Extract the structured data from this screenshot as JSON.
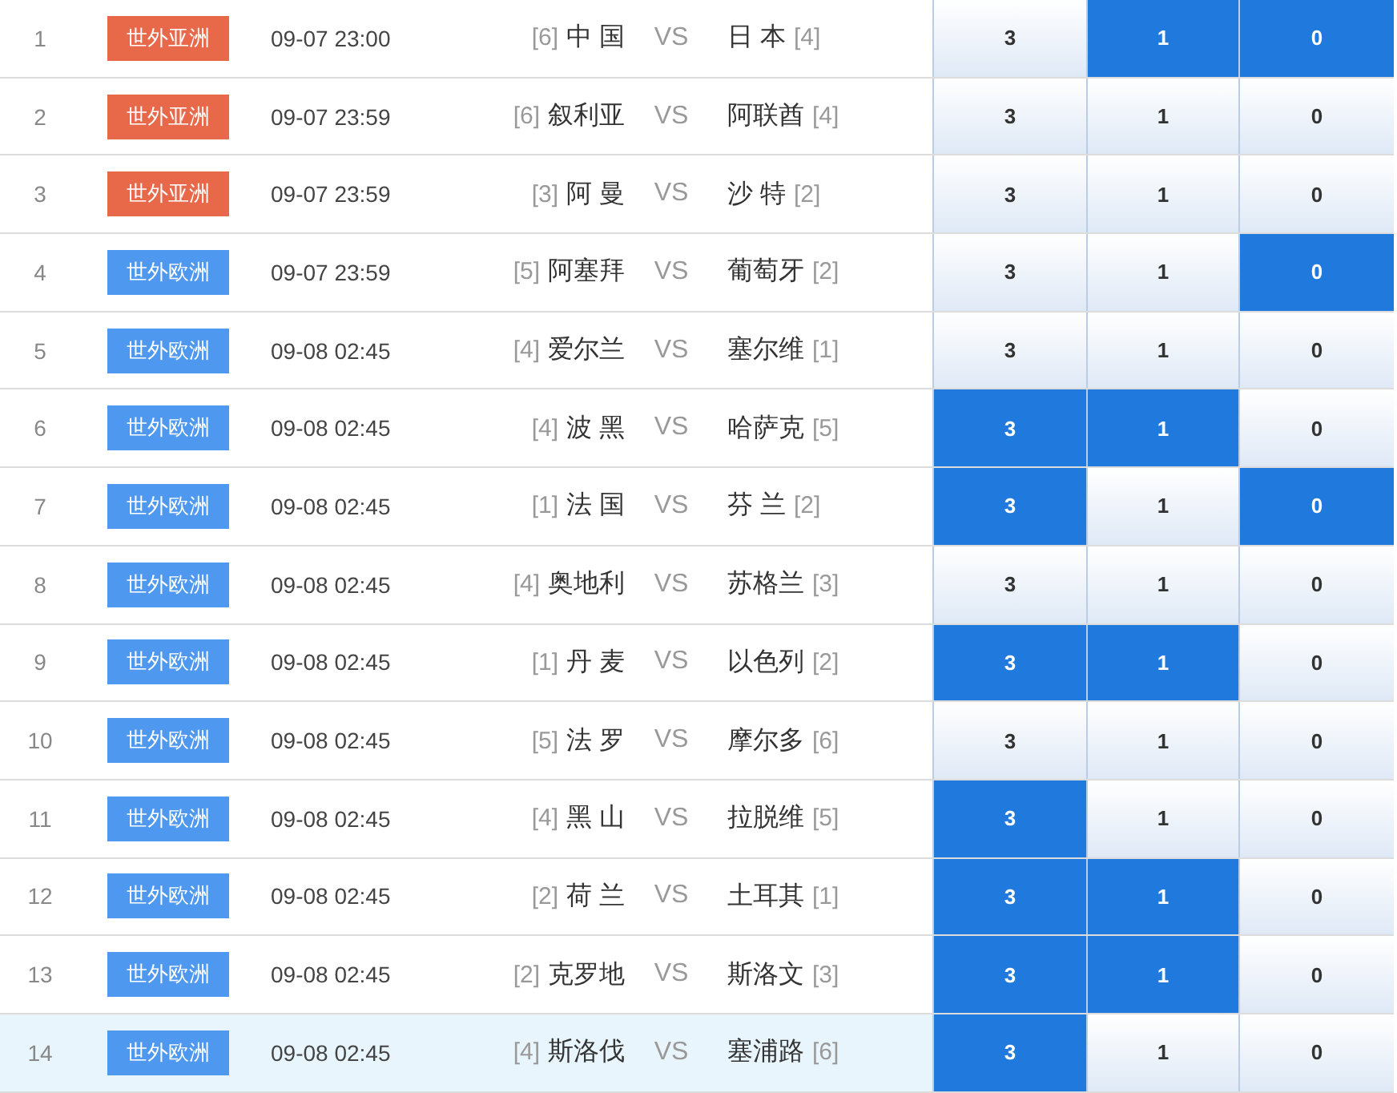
{
  "matches": [
    {
      "number": "1",
      "league": {
        "label": "世外亚洲",
        "kind": "asia"
      },
      "time": "09-07 23:00",
      "home": {
        "rank": "[6]",
        "name": "中 国"
      },
      "vs": "VS",
      "away": {
        "name": "日 本",
        "rank": "[4]"
      },
      "highlighted": false,
      "odds": [
        {
          "value": "3",
          "selected": false
        },
        {
          "value": "1",
          "selected": true
        },
        {
          "value": "0",
          "selected": true
        }
      ]
    },
    {
      "number": "2",
      "league": {
        "label": "世外亚洲",
        "kind": "asia"
      },
      "time": "09-07 23:59",
      "home": {
        "rank": "[6]",
        "name": "叙利亚"
      },
      "vs": "VS",
      "away": {
        "name": "阿联酋",
        "rank": "[4]"
      },
      "highlighted": false,
      "odds": [
        {
          "value": "3",
          "selected": false
        },
        {
          "value": "1",
          "selected": false
        },
        {
          "value": "0",
          "selected": false
        }
      ]
    },
    {
      "number": "3",
      "league": {
        "label": "世外亚洲",
        "kind": "asia"
      },
      "time": "09-07 23:59",
      "home": {
        "rank": "[3]",
        "name": "阿 曼"
      },
      "vs": "VS",
      "away": {
        "name": "沙 特",
        "rank": "[2]"
      },
      "highlighted": false,
      "odds": [
        {
          "value": "3",
          "selected": false
        },
        {
          "value": "1",
          "selected": false
        },
        {
          "value": "0",
          "selected": false
        }
      ]
    },
    {
      "number": "4",
      "league": {
        "label": "世外欧洲",
        "kind": "europe"
      },
      "time": "09-07 23:59",
      "home": {
        "rank": "[5]",
        "name": "阿塞拜"
      },
      "vs": "VS",
      "away": {
        "name": "葡萄牙",
        "rank": "[2]"
      },
      "highlighted": false,
      "odds": [
        {
          "value": "3",
          "selected": false
        },
        {
          "value": "1",
          "selected": false
        },
        {
          "value": "0",
          "selected": true
        }
      ]
    },
    {
      "number": "5",
      "league": {
        "label": "世外欧洲",
        "kind": "europe"
      },
      "time": "09-08 02:45",
      "home": {
        "rank": "[4]",
        "name": "爱尔兰"
      },
      "vs": "VS",
      "away": {
        "name": "塞尔维",
        "rank": "[1]"
      },
      "highlighted": false,
      "odds": [
        {
          "value": "3",
          "selected": false
        },
        {
          "value": "1",
          "selected": false
        },
        {
          "value": "0",
          "selected": false
        }
      ]
    },
    {
      "number": "6",
      "league": {
        "label": "世外欧洲",
        "kind": "europe"
      },
      "time": "09-08 02:45",
      "home": {
        "rank": "[4]",
        "name": "波 黑"
      },
      "vs": "VS",
      "away": {
        "name": "哈萨克",
        "rank": "[5]"
      },
      "highlighted": false,
      "odds": [
        {
          "value": "3",
          "selected": true
        },
        {
          "value": "1",
          "selected": true
        },
        {
          "value": "0",
          "selected": false
        }
      ]
    },
    {
      "number": "7",
      "league": {
        "label": "世外欧洲",
        "kind": "europe"
      },
      "time": "09-08 02:45",
      "home": {
        "rank": "[1]",
        "name": "法 国"
      },
      "vs": "VS",
      "away": {
        "name": "芬 兰",
        "rank": "[2]"
      },
      "highlighted": false,
      "odds": [
        {
          "value": "3",
          "selected": true
        },
        {
          "value": "1",
          "selected": false
        },
        {
          "value": "0",
          "selected": true
        }
      ]
    },
    {
      "number": "8",
      "league": {
        "label": "世外欧洲",
        "kind": "europe"
      },
      "time": "09-08 02:45",
      "home": {
        "rank": "[4]",
        "name": "奥地利"
      },
      "vs": "VS",
      "away": {
        "name": "苏格兰",
        "rank": "[3]"
      },
      "highlighted": false,
      "odds": [
        {
          "value": "3",
          "selected": false
        },
        {
          "value": "1",
          "selected": false
        },
        {
          "value": "0",
          "selected": false
        }
      ]
    },
    {
      "number": "9",
      "league": {
        "label": "世外欧洲",
        "kind": "europe"
      },
      "time": "09-08 02:45",
      "home": {
        "rank": "[1]",
        "name": "丹 麦"
      },
      "vs": "VS",
      "away": {
        "name": "以色列",
        "rank": "[2]"
      },
      "highlighted": false,
      "odds": [
        {
          "value": "3",
          "selected": true
        },
        {
          "value": "1",
          "selected": true
        },
        {
          "value": "0",
          "selected": false
        }
      ]
    },
    {
      "number": "10",
      "league": {
        "label": "世外欧洲",
        "kind": "europe"
      },
      "time": "09-08 02:45",
      "home": {
        "rank": "[5]",
        "name": "法 罗"
      },
      "vs": "VS",
      "away": {
        "name": "摩尔多",
        "rank": "[6]"
      },
      "highlighted": false,
      "odds": [
        {
          "value": "3",
          "selected": false
        },
        {
          "value": "1",
          "selected": false
        },
        {
          "value": "0",
          "selected": false
        }
      ]
    },
    {
      "number": "11",
      "league": {
        "label": "世外欧洲",
        "kind": "europe"
      },
      "time": "09-08 02:45",
      "home": {
        "rank": "[4]",
        "name": "黑 山"
      },
      "vs": "VS",
      "away": {
        "name": "拉脱维",
        "rank": "[5]"
      },
      "highlighted": false,
      "odds": [
        {
          "value": "3",
          "selected": true
        },
        {
          "value": "1",
          "selected": false
        },
        {
          "value": "0",
          "selected": false
        }
      ]
    },
    {
      "number": "12",
      "league": {
        "label": "世外欧洲",
        "kind": "europe"
      },
      "time": "09-08 02:45",
      "home": {
        "rank": "[2]",
        "name": "荷 兰"
      },
      "vs": "VS",
      "away": {
        "name": "土耳其",
        "rank": "[1]"
      },
      "highlighted": false,
      "odds": [
        {
          "value": "3",
          "selected": true
        },
        {
          "value": "1",
          "selected": true
        },
        {
          "value": "0",
          "selected": false
        }
      ]
    },
    {
      "number": "13",
      "league": {
        "label": "世外欧洲",
        "kind": "europe"
      },
      "time": "09-08 02:45",
      "home": {
        "rank": "[2]",
        "name": "克罗地"
      },
      "vs": "VS",
      "away": {
        "name": "斯洛文",
        "rank": "[3]"
      },
      "highlighted": false,
      "odds": [
        {
          "value": "3",
          "selected": true
        },
        {
          "value": "1",
          "selected": true
        },
        {
          "value": "0",
          "selected": false
        }
      ]
    },
    {
      "number": "14",
      "league": {
        "label": "世外欧洲",
        "kind": "europe"
      },
      "time": "09-08 02:45",
      "home": {
        "rank": "[4]",
        "name": "斯洛伐"
      },
      "vs": "VS",
      "away": {
        "name": "塞浦路",
        "rank": "[6]"
      },
      "highlighted": true,
      "odds": [
        {
          "value": "3",
          "selected": true
        },
        {
          "value": "1",
          "selected": false
        },
        {
          "value": "0",
          "selected": false
        }
      ]
    }
  ]
}
